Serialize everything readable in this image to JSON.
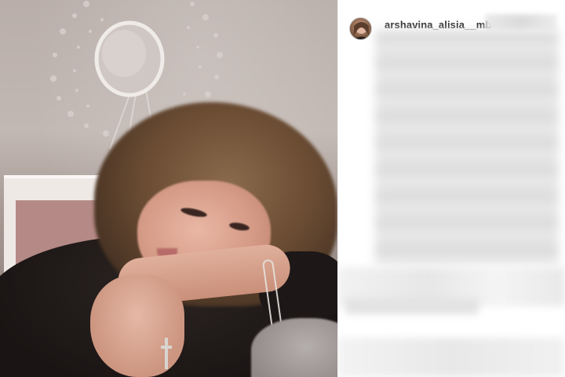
{
  "post": {
    "username": "arshavina_alisia__mb",
    "avatar_icon": "profile-avatar",
    "caption_redacted": true,
    "actions_redacted": true,
    "comments_redacted": true
  },
  "photo": {
    "subject": "selfie-photo"
  },
  "colors": {
    "panel_background": "#ffffff",
    "username_text": "#262626"
  }
}
